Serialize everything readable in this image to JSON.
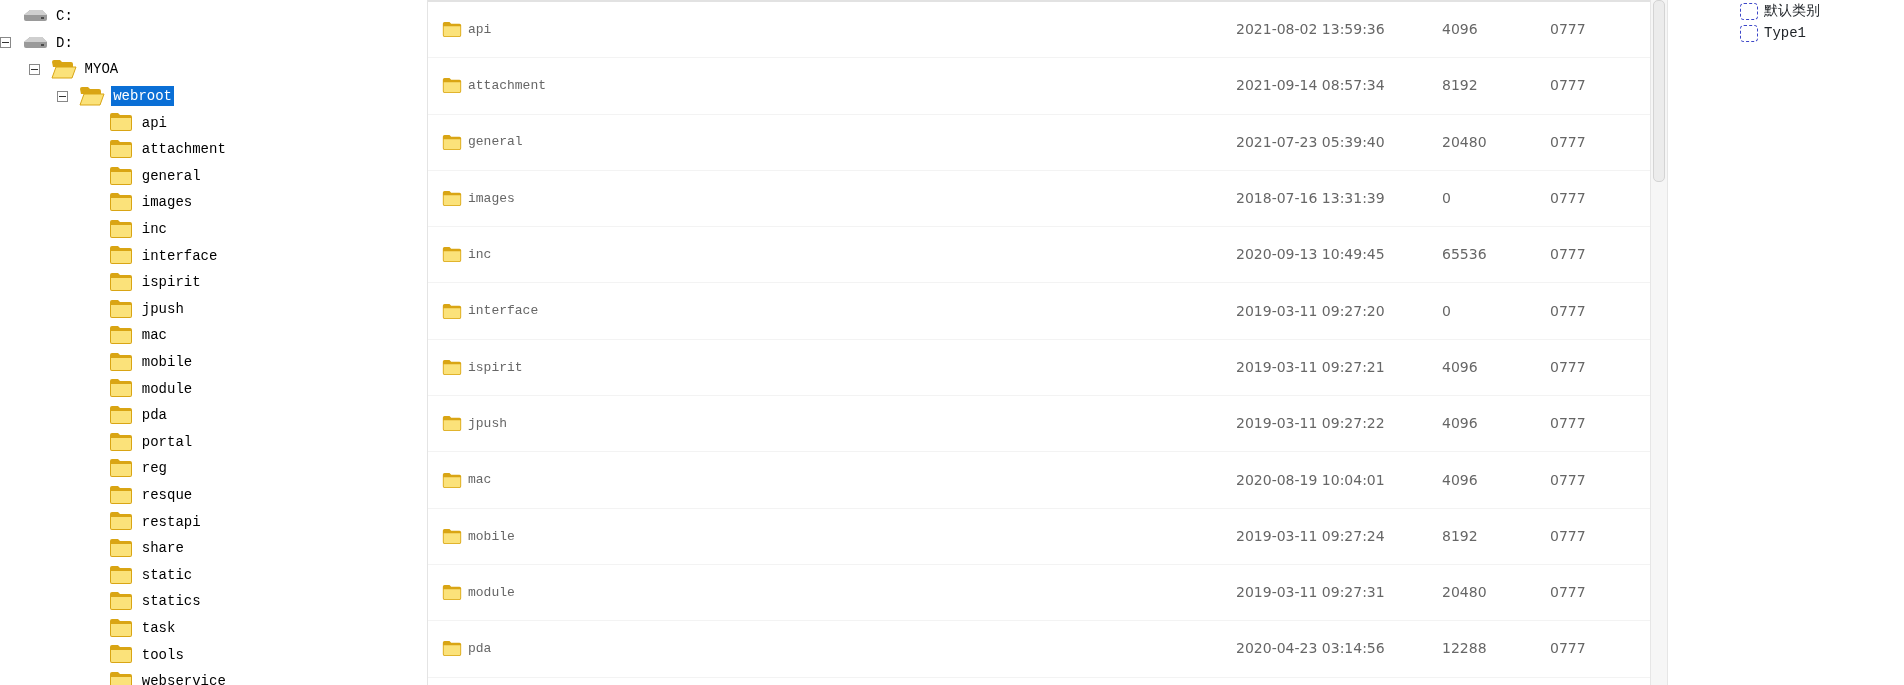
{
  "tree": [
    {
      "label": "C:",
      "kind": "drive",
      "selected": false
    },
    {
      "label": "D:",
      "kind": "drive",
      "selected": false,
      "expanded": true,
      "children": [
        {
          "label": "MYOA",
          "kind": "folder",
          "selected": false,
          "expanded": true,
          "children": [
            {
              "label": "webroot",
              "kind": "folder",
              "selected": true,
              "expanded": true,
              "children": [
                {
                  "label": "api",
                  "kind": "folder",
                  "selected": false
                },
                {
                  "label": "attachment",
                  "kind": "folder",
                  "selected": false
                },
                {
                  "label": "general",
                  "kind": "folder",
                  "selected": false
                },
                {
                  "label": "images",
                  "kind": "folder",
                  "selected": false
                },
                {
                  "label": "inc",
                  "kind": "folder",
                  "selected": false
                },
                {
                  "label": "interface",
                  "kind": "folder",
                  "selected": false
                },
                {
                  "label": "ispirit",
                  "kind": "folder",
                  "selected": false
                },
                {
                  "label": "jpush",
                  "kind": "folder",
                  "selected": false
                },
                {
                  "label": "mac",
                  "kind": "folder",
                  "selected": false
                },
                {
                  "label": "mobile",
                  "kind": "folder",
                  "selected": false
                },
                {
                  "label": "module",
                  "kind": "folder",
                  "selected": false
                },
                {
                  "label": "pda",
                  "kind": "folder",
                  "selected": false
                },
                {
                  "label": "portal",
                  "kind": "folder",
                  "selected": false
                },
                {
                  "label": "reg",
                  "kind": "folder",
                  "selected": false
                },
                {
                  "label": "resque",
                  "kind": "folder",
                  "selected": false
                },
                {
                  "label": "restapi",
                  "kind": "folder",
                  "selected": false
                },
                {
                  "label": "share",
                  "kind": "folder",
                  "selected": false
                },
                {
                  "label": "static",
                  "kind": "folder",
                  "selected": false
                },
                {
                  "label": "statics",
                  "kind": "folder",
                  "selected": false
                },
                {
                  "label": "task",
                  "kind": "folder",
                  "selected": false
                },
                {
                  "label": "tools",
                  "kind": "folder",
                  "selected": false
                },
                {
                  "label": "webservice",
                  "kind": "folder",
                  "selected": false
                }
              ]
            }
          ]
        }
      ]
    }
  ],
  "files": [
    {
      "name": "api",
      "modified": "2021-08-02 13:59:36",
      "size": "4096",
      "permissions": "0777"
    },
    {
      "name": "attachment",
      "modified": "2021-09-14 08:57:34",
      "size": "8192",
      "permissions": "0777"
    },
    {
      "name": "general",
      "modified": "2021-07-23 05:39:40",
      "size": "20480",
      "permissions": "0777"
    },
    {
      "name": "images",
      "modified": "2018-07-16 13:31:39",
      "size": "0",
      "permissions": "0777"
    },
    {
      "name": "inc",
      "modified": "2020-09-13 10:49:45",
      "size": "65536",
      "permissions": "0777"
    },
    {
      "name": "interface",
      "modified": "2019-03-11 09:27:20",
      "size": "0",
      "permissions": "0777"
    },
    {
      "name": "ispirit",
      "modified": "2019-03-11 09:27:21",
      "size": "4096",
      "permissions": "0777"
    },
    {
      "name": "jpush",
      "modified": "2019-03-11 09:27:22",
      "size": "4096",
      "permissions": "0777"
    },
    {
      "name": "mac",
      "modified": "2020-08-19 10:04:01",
      "size": "4096",
      "permissions": "0777"
    },
    {
      "name": "mobile",
      "modified": "2019-03-11 09:27:24",
      "size": "8192",
      "permissions": "0777"
    },
    {
      "name": "module",
      "modified": "2019-03-11 09:27:31",
      "size": "20480",
      "permissions": "0777"
    },
    {
      "name": "pda",
      "modified": "2020-04-23 03:14:56",
      "size": "12288",
      "permissions": "0777"
    }
  ],
  "categories": [
    {
      "label": "默认类别",
      "checked": false
    },
    {
      "label": "Type1",
      "checked": false
    }
  ]
}
